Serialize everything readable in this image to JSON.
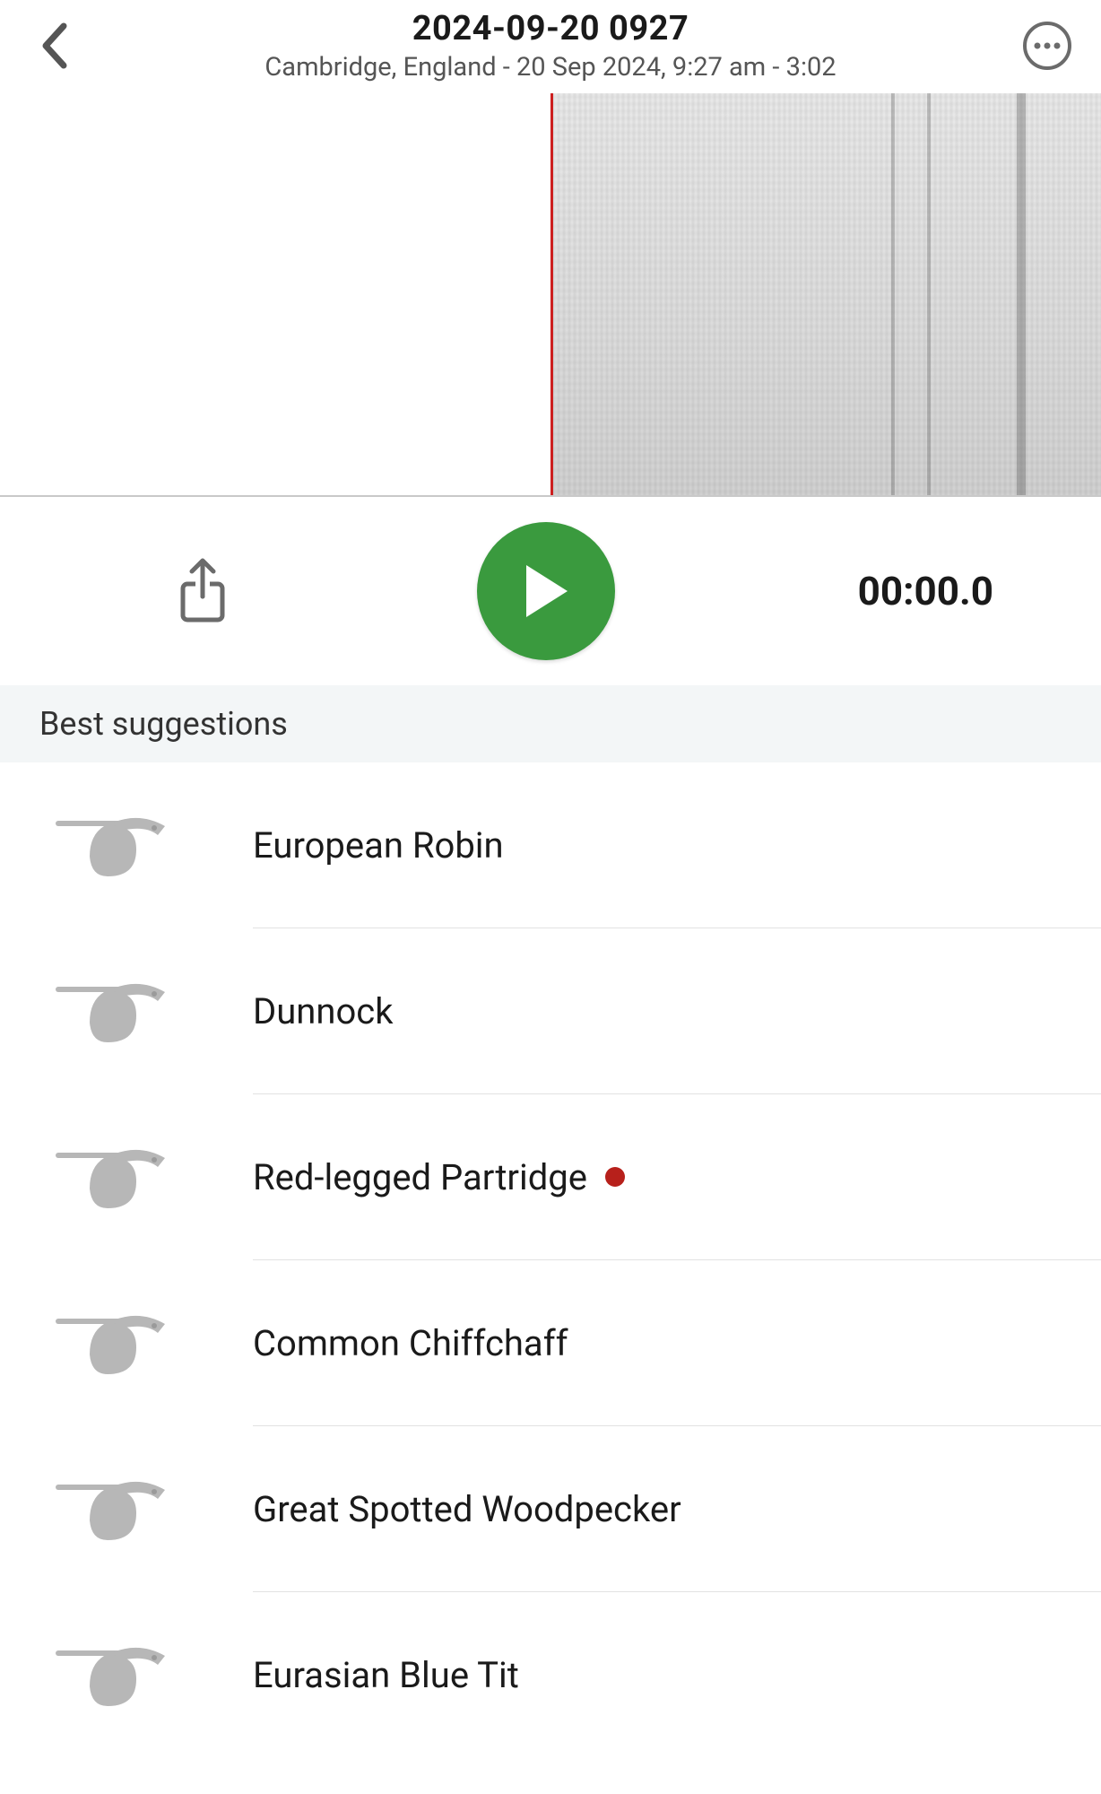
{
  "header": {
    "title": "2024-09-20 0927",
    "subtitle": "Cambridge, England - 20 Sep 2024, 9:27 am - 3:02"
  },
  "playback": {
    "time": "00:00.0"
  },
  "section": {
    "best_suggestions_label": "Best suggestions"
  },
  "suggestions": [
    {
      "name": "European Robin",
      "flag": false
    },
    {
      "name": "Dunnock",
      "flag": false
    },
    {
      "name": "Red-legged Partridge",
      "flag": true
    },
    {
      "name": "Common Chiffchaff",
      "flag": false
    },
    {
      "name": "Great Spotted Woodpecker",
      "flag": false
    },
    {
      "name": "Eurasian Blue Tit",
      "flag": false
    }
  ],
  "colors": {
    "accent_green": "#3a9a3e",
    "flag_red": "#b7201b",
    "playhead_red": "#cc1f1f"
  }
}
